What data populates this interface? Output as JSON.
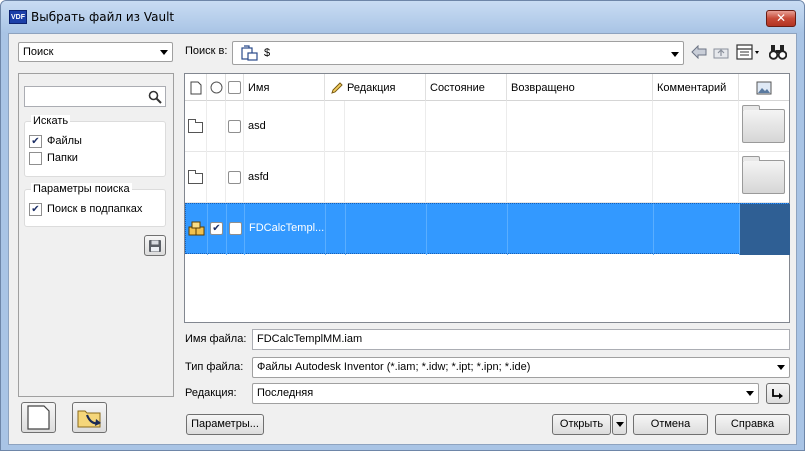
{
  "window": {
    "title": "Выбрать файл из Vault",
    "logo": "VDF",
    "close": "✕"
  },
  "left": {
    "mode_select": "Поиск",
    "search_placeholder": "",
    "search_group": {
      "title": "Искать",
      "files": "Файлы",
      "folders": "Папки"
    },
    "params_group": {
      "title": "Параметры поиска",
      "subfolders": "Поиск в подпапках"
    }
  },
  "toolbar": {
    "look_in_label": "Поиск в:",
    "path": "$"
  },
  "grid": {
    "columns": [
      "Имя",
      "Редакция",
      "Состояние",
      "Возвращено",
      "Комментарий"
    ],
    "rows": [
      {
        "name": "asd",
        "selected": false
      },
      {
        "name": "asfd",
        "selected": false
      },
      {
        "name": "FDCalcTempl...",
        "selected": true
      }
    ]
  },
  "form": {
    "filename_label": "Имя файла:",
    "filename_value": "FDCalcTemplMM.iam",
    "filetype_label": "Тип файла:",
    "filetype_value": "Файлы Autodesk Inventor (*.iam; *.idw; *.ipt; *.ipn; *.ide)",
    "revision_label": "Редакция:",
    "revision_value": "Последняя"
  },
  "buttons": {
    "params": "Параметры...",
    "open": "Открыть",
    "cancel": "Отмена",
    "help": "Справка"
  },
  "icons": {
    "search": "magnifier-icon",
    "save": "floppy-disk-icon",
    "back": "back-arrow-icon",
    "up": "up-folder-icon",
    "views": "views-icon",
    "find": "binoculars-icon"
  }
}
